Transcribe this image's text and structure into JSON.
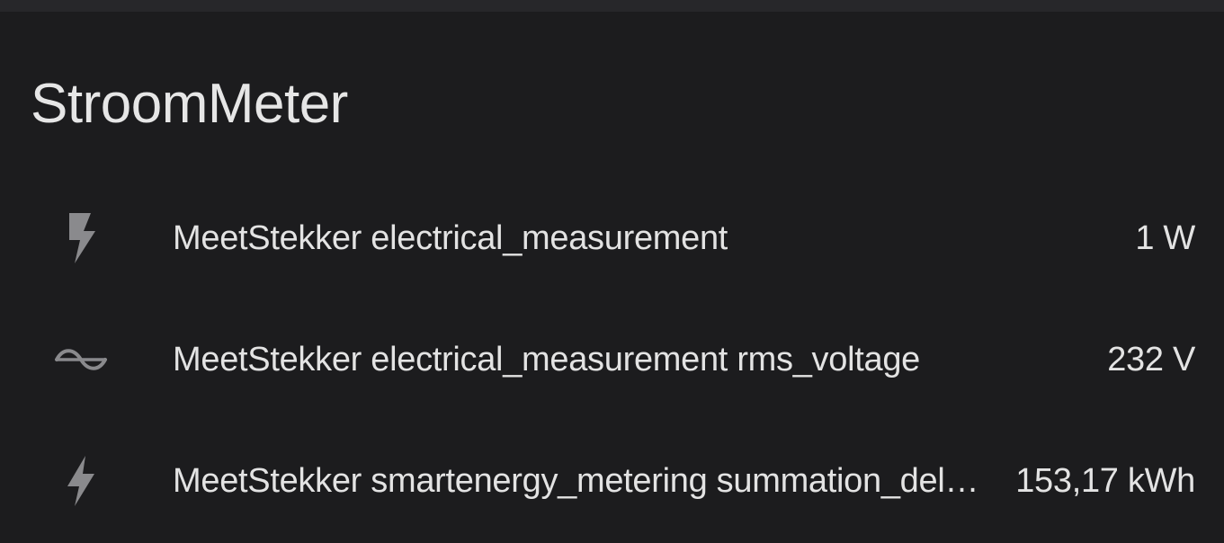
{
  "card": {
    "title": "StroomMeter",
    "entities": [
      {
        "icon": "flash-icon",
        "name": "MeetStekker electrical_measurement",
        "state": "1 W"
      },
      {
        "icon": "sine-wave-icon",
        "name": "MeetStekker electrical_measurement rms_voltage",
        "state": "232 V"
      },
      {
        "icon": "flash-icon",
        "name": "MeetStekker smartenergy_metering summation_delivered",
        "state": "153,17 kWh"
      }
    ]
  },
  "colors": {
    "background": "#1c1c1e",
    "topbar": "#27272a",
    "text": "#e3e3e3",
    "icon": "#8a8a8d"
  }
}
